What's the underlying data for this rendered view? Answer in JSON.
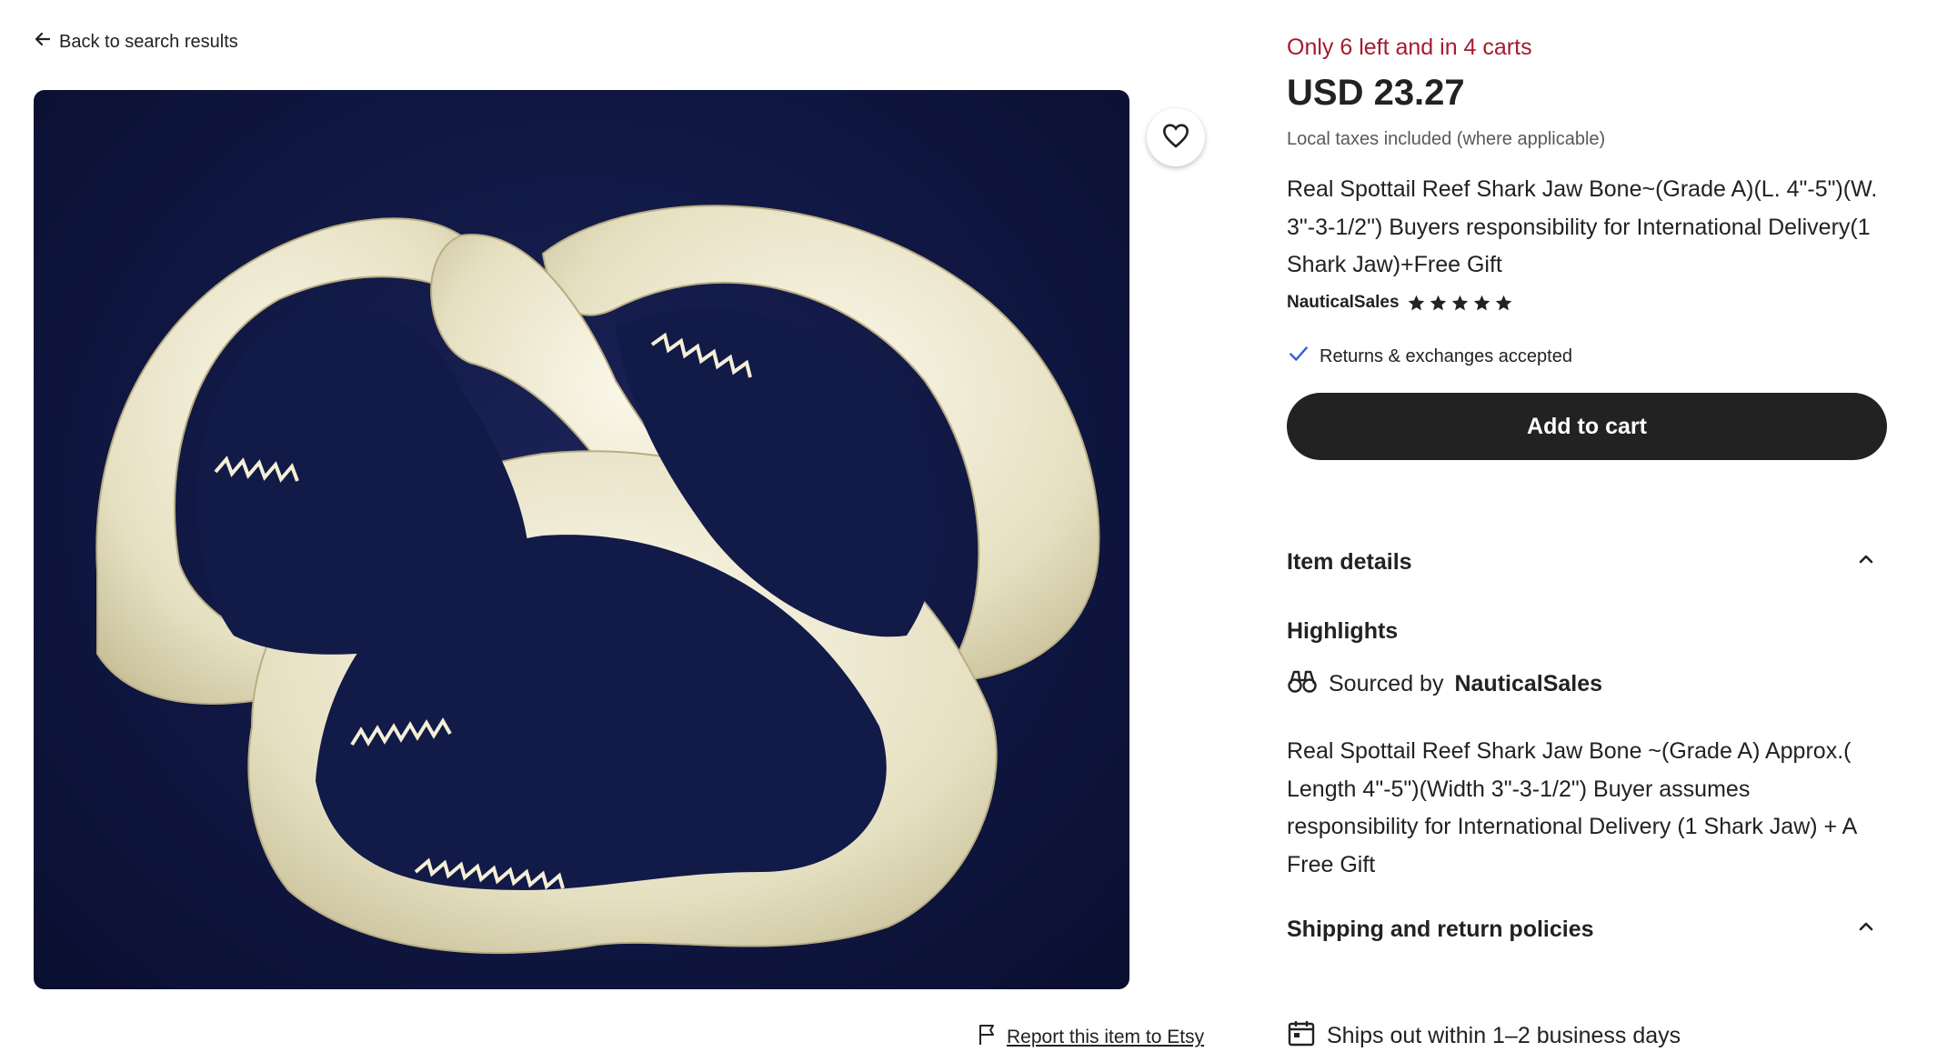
{
  "nav": {
    "back_label": "Back to search results",
    "back_icon": "arrow-left-icon"
  },
  "media": {
    "image_alt": "",
    "favorite_icon": "heart-icon"
  },
  "report": {
    "label": "Report this item to Etsy",
    "icon": "flag-icon"
  },
  "listing": {
    "stock_text": "Only 6 left and in 4 carts",
    "price": "USD 23.27",
    "taxes_note": "Local taxes included (where applicable)",
    "title": "Real Spottail Reef Shark Jaw Bone~(Grade A)(L. 4\"-5\")(W. 3\"-3-1/2\") Buyers responsibility for International Delivery(1 Shark Jaw)+Free Gift",
    "shop_name": "NauticalSales",
    "rating_stars": 5,
    "returns_text": "Returns & exchanges accepted",
    "add_to_cart_label": "Add to cart"
  },
  "item_details": {
    "heading": "Item details",
    "highlights_heading": "Highlights",
    "sourced_prefix": "Sourced by",
    "sourced_shop": "NauticalSales",
    "description": "Real Spottail Reef Shark Jaw Bone ~(Grade A) Approx.( Length 4\"-5\")(Width 3\"-3-1/2\") Buyer assumes responsibility for International Delivery (1 Shark Jaw) + A Free Gift"
  },
  "shipping": {
    "heading": "Shipping and return policies",
    "ships_text": "Ships out within 1–2 business days"
  },
  "colors": {
    "stock_red": "#a61a2e",
    "button_dark": "#222222",
    "check_blue": "#2f5cd9",
    "image_bg": "#0f1640"
  }
}
